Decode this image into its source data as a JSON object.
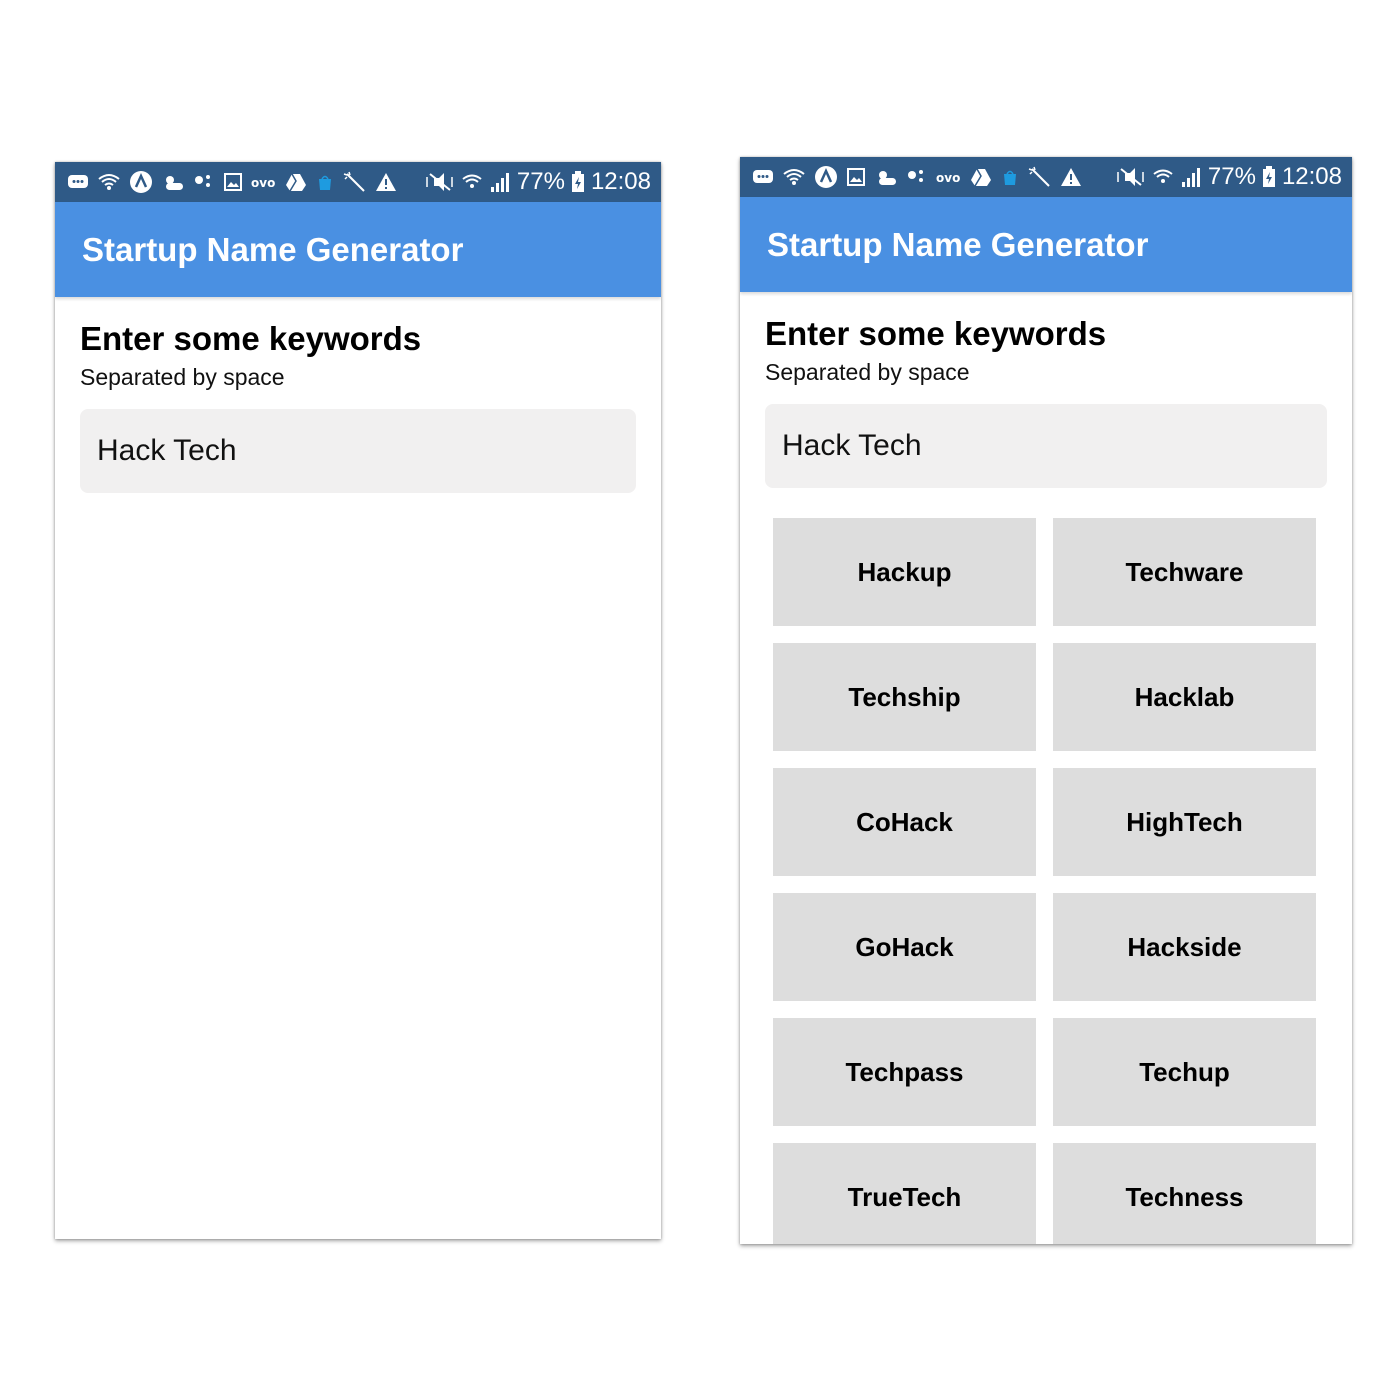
{
  "status_bar": {
    "battery_text": "77%",
    "time": "12:08",
    "icons": [
      "message-icon",
      "wifi-icon",
      "navigation-icon",
      "weather-icon",
      "dots-icon",
      "image-icon",
      "ovo-icon",
      "drive-icon",
      "bag-icon",
      "magic-wand-icon",
      "warning-icon",
      "mute-icon",
      "wifi-calling-icon",
      "signal-icon",
      "battery-charging-icon"
    ]
  },
  "app": {
    "title": "Startup Name Generator"
  },
  "form": {
    "heading": "Enter some keywords",
    "subheading": "Separated by space",
    "input_value": "Hack Tech"
  },
  "results": [
    "Hackup",
    "Techware",
    "Techship",
    "Hacklab",
    "CoHack",
    "HighTech",
    "GoHack",
    "Hackside",
    "Techpass",
    "Techup",
    "TrueTech",
    "Techness"
  ],
  "colors": {
    "status_bar": "#2f5a87",
    "app_bar": "#4a90e2",
    "input_bg": "#f1f0f0",
    "card_bg": "#dddddd"
  }
}
